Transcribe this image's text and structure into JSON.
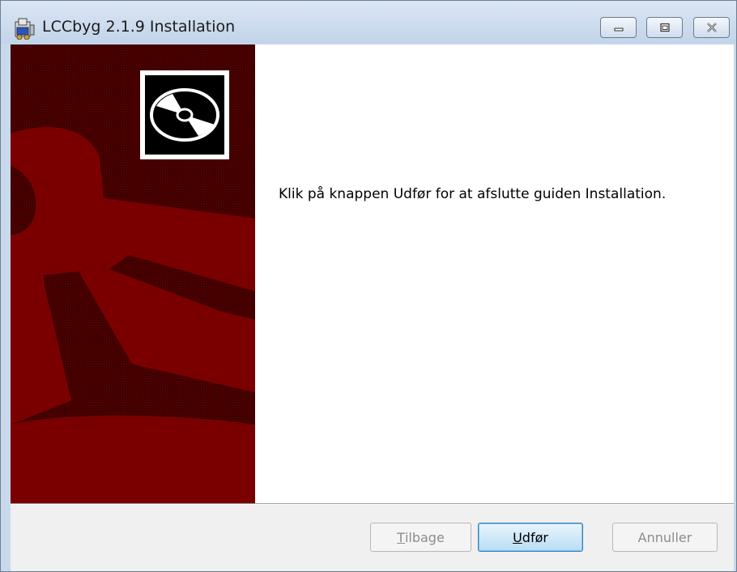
{
  "window": {
    "title": "LCCbyg 2.1.9 Installation"
  },
  "titlebar_buttons": {
    "minimize_icon": "minimize-icon",
    "maximize_icon": "maximize-icon",
    "close_icon": "close-icon"
  },
  "main": {
    "message": "Klik på knappen Udfør for at afslutte guiden Installation."
  },
  "buttons": {
    "back_prefix": "",
    "back_access": "T",
    "back_rest": "ilbage",
    "finish_access": "U",
    "finish_rest": "dfør",
    "cancel": "Annuller"
  },
  "colors": {
    "panel_dark": "#3a0000",
    "panel_red": "#7a0000",
    "accent_blue": "#3c7fb1"
  }
}
